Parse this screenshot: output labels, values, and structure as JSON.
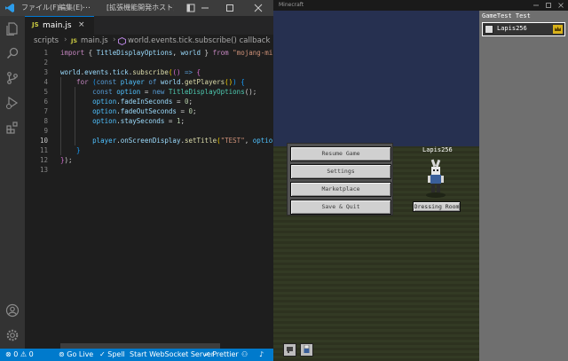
{
  "vscode": {
    "menu": [
      "ファイル(F)",
      "編集(E)"
    ],
    "menu_more": "…",
    "window_title": "[拡張機能開発ホスト]",
    "tab": {
      "icon": "JS",
      "label": "main.js",
      "close": "×"
    },
    "breadcrumb": [
      "scripts",
      "main.js",
      "world.events.tick.subscribe() callback"
    ],
    "line_numbers": [
      "1",
      "2",
      "3",
      "4",
      "5",
      "6",
      "7",
      "8",
      "9",
      "10",
      "11",
      "12",
      "13"
    ],
    "active_line": "10",
    "code": {
      "l1": [
        {
          "t": "import ",
          "c": "#c586c0"
        },
        {
          "t": "{ ",
          "c": "#d4d4d4"
        },
        {
          "t": "TitleDisplayOptions",
          "c": "#9cdcfe"
        },
        {
          "t": ", ",
          "c": "#d4d4d4"
        },
        {
          "t": "world",
          "c": "#9cdcfe"
        },
        {
          "t": " } ",
          "c": "#d4d4d4"
        },
        {
          "t": "from ",
          "c": "#c586c0"
        },
        {
          "t": "\"mojang-minecraft",
          "c": "#ce9178"
        }
      ],
      "l3": [
        {
          "t": "world",
          "c": "#9cdcfe"
        },
        {
          "t": ".",
          "c": "#d4d4d4"
        },
        {
          "t": "events",
          "c": "#9cdcfe"
        },
        {
          "t": ".",
          "c": "#d4d4d4"
        },
        {
          "t": "tick",
          "c": "#9cdcfe"
        },
        {
          "t": ".",
          "c": "#d4d4d4"
        },
        {
          "t": "subscribe",
          "c": "#dcdcaa"
        },
        {
          "t": "(",
          "c": "#ffd700"
        },
        {
          "t": "() ",
          "c": "#da70d6"
        },
        {
          "t": "=> ",
          "c": "#569cd6"
        },
        {
          "t": "{",
          "c": "#da70d6"
        }
      ],
      "l4": [
        {
          "t": "    for ",
          "c": "#c586c0"
        },
        {
          "t": "(",
          "c": "#179fff"
        },
        {
          "t": "const ",
          "c": "#569cd6"
        },
        {
          "t": "player ",
          "c": "#4fc1ff"
        },
        {
          "t": "of ",
          "c": "#569cd6"
        },
        {
          "t": "world",
          "c": "#9cdcfe"
        },
        {
          "t": ".",
          "c": "#d4d4d4"
        },
        {
          "t": "getPlayers",
          "c": "#dcdcaa"
        },
        {
          "t": "()",
          "c": "#ffd700"
        },
        {
          "t": ") ",
          "c": "#179fff"
        },
        {
          "t": "{",
          "c": "#179fff"
        }
      ],
      "l5": [
        {
          "t": "        const ",
          "c": "#569cd6"
        },
        {
          "t": "option ",
          "c": "#4fc1ff"
        },
        {
          "t": "= ",
          "c": "#d4d4d4"
        },
        {
          "t": "new ",
          "c": "#569cd6"
        },
        {
          "t": "TitleDisplayOptions",
          "c": "#4ec9b0"
        },
        {
          "t": "();",
          "c": "#d4d4d4"
        }
      ],
      "l6": [
        {
          "t": "        option",
          "c": "#4fc1ff"
        },
        {
          "t": ".",
          "c": "#d4d4d4"
        },
        {
          "t": "fadeInSeconds",
          "c": "#9cdcfe"
        },
        {
          "t": " = ",
          "c": "#d4d4d4"
        },
        {
          "t": "0",
          "c": "#b5cea8"
        },
        {
          "t": ";",
          "c": "#d4d4d4"
        }
      ],
      "l7": [
        {
          "t": "        option",
          "c": "#4fc1ff"
        },
        {
          "t": ".",
          "c": "#d4d4d4"
        },
        {
          "t": "fadeOutSeconds",
          "c": "#9cdcfe"
        },
        {
          "t": " = ",
          "c": "#d4d4d4"
        },
        {
          "t": "0",
          "c": "#b5cea8"
        },
        {
          "t": ";",
          "c": "#d4d4d4"
        }
      ],
      "l8": [
        {
          "t": "        option",
          "c": "#4fc1ff"
        },
        {
          "t": ".",
          "c": "#d4d4d4"
        },
        {
          "t": "staySeconds",
          "c": "#9cdcfe"
        },
        {
          "t": " = ",
          "c": "#d4d4d4"
        },
        {
          "t": "1",
          "c": "#b5cea8"
        },
        {
          "t": ";",
          "c": "#d4d4d4"
        }
      ],
      "l10": [
        {
          "t": "        player",
          "c": "#4fc1ff"
        },
        {
          "t": ".",
          "c": "#d4d4d4"
        },
        {
          "t": "onScreenDisplay",
          "c": "#9cdcfe"
        },
        {
          "t": ".",
          "c": "#d4d4d4"
        },
        {
          "t": "setTitle",
          "c": "#dcdcaa"
        },
        {
          "t": "(",
          "c": "#ffd700"
        },
        {
          "t": "\"TEST\"",
          "c": "#ce9178"
        },
        {
          "t": ", ",
          "c": "#d4d4d4"
        },
        {
          "t": "option",
          "c": "#4fc1ff"
        },
        {
          "t": ");",
          "c": "#d4d4d4"
        }
      ],
      "l11": [
        {
          "t": "    }",
          "c": "#179fff"
        }
      ],
      "l12": [
        {
          "t": "}",
          "c": "#da70d6"
        },
        {
          "t": ");",
          "c": "#d4d4d4"
        }
      ]
    },
    "status": {
      "errors": "0",
      "warnings": "0",
      "go_live": "Go Live",
      "spell": "Spell",
      "websocket": "Start WebSocket Server",
      "prettier": "Prettier"
    }
  },
  "minecraft": {
    "window_title": "Minecraft",
    "panel_title": "GameTest Test",
    "player_name": "Lapis256",
    "nametag": "Lapis256",
    "menu_buttons": [
      "Resume Game",
      "Settings",
      "Marketplace",
      "Save & Quit"
    ],
    "dressing_room": "Dressing Room"
  },
  "colors": {
    "vscode_bg": "#1e1e1e",
    "statusbar": "#007acc",
    "sky": "#263050",
    "ground": "#2d321f",
    "mc_panel": "#6f6f6f"
  },
  "icons": [
    "vscode-logo-icon",
    "explorer-icon",
    "search-icon",
    "source-control-icon",
    "run-debug-icon",
    "extensions-icon",
    "account-icon",
    "settings-gear-icon"
  ]
}
